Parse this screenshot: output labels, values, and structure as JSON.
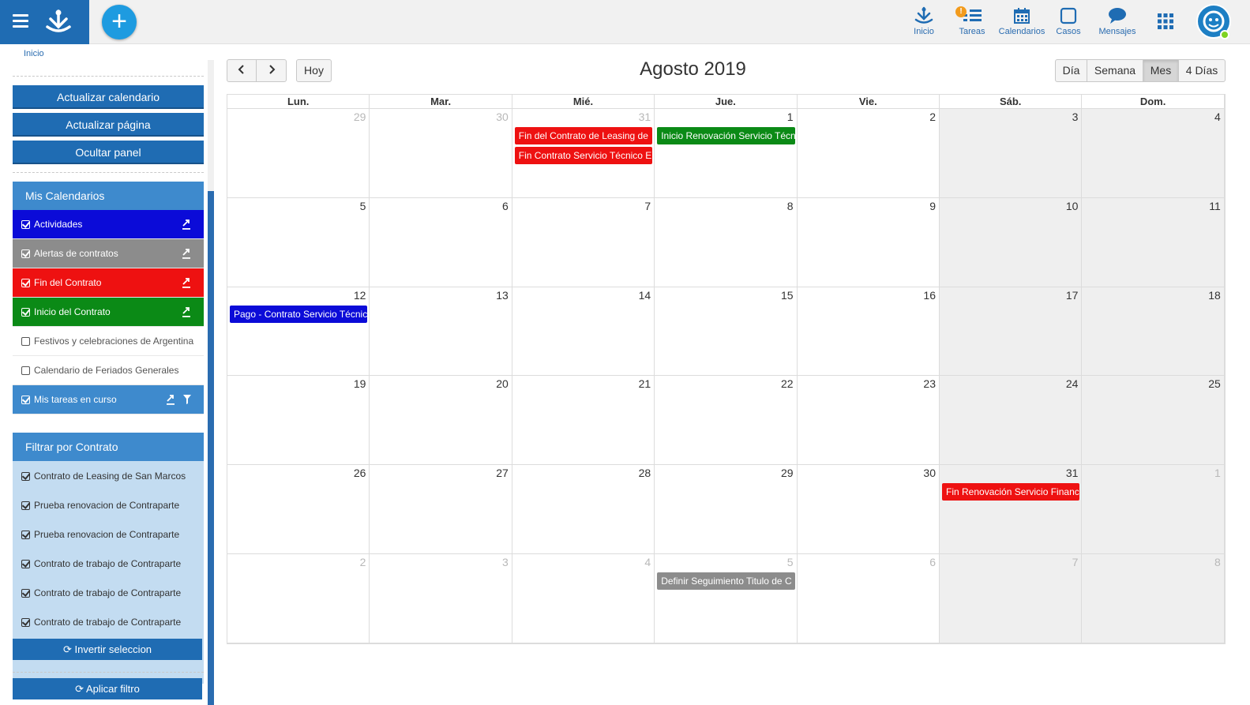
{
  "topbar": {
    "nav": [
      {
        "key": "inicio",
        "label": "Inicio",
        "icon": "home-logo-icon"
      },
      {
        "key": "tareas",
        "label": "Tareas",
        "icon": "tasks-icon",
        "badge": "!"
      },
      {
        "key": "calendarios",
        "label": "Calendarios",
        "icon": "calendar-icon"
      },
      {
        "key": "casos",
        "label": "Casos",
        "icon": "square-icon"
      },
      {
        "key": "mensajes",
        "label": "Mensajes",
        "icon": "chat-icon"
      }
    ],
    "accent": "#1f6cb3"
  },
  "sidebar": {
    "breadcrumb": "Inicio",
    "buttons": {
      "refresh_calendar": "Actualizar calendario",
      "refresh_page": "Actualizar página",
      "hide_panel": "Ocultar panel"
    },
    "my_calendars_title": "Mis Calendarios",
    "calendars": [
      {
        "label": "Actividades",
        "checked": true,
        "color": "#0b0bd8"
      },
      {
        "label": "Alertas de contratos",
        "checked": true,
        "color": "#8c8c8c"
      },
      {
        "label": "Fin del Contrato",
        "checked": true,
        "color": "#ee1111"
      },
      {
        "label": "Inicio del Contrato",
        "checked": true,
        "color": "#0b8a16"
      },
      {
        "label": "Festivos y celebraciones de Argentina",
        "checked": false,
        "color": "#ffffff"
      },
      {
        "label": "Calendario de Feriados Generales",
        "checked": false,
        "color": "#ffffff"
      },
      {
        "label": "Mis tareas en curso",
        "checked": true,
        "color": "#3e8acd"
      }
    ],
    "filter_title": "Filtrar por Contrato",
    "filters": [
      "Contrato de Leasing de San Marcos",
      "Prueba renovacion de Contraparte",
      "Prueba renovacion de Contraparte",
      "Contrato de trabajo de Contraparte",
      "Contrato de trabajo de Contraparte",
      "Contrato de trabajo de Contraparte"
    ],
    "invert_label": "Invertir seleccion",
    "apply_label": "Aplicar filtro"
  },
  "calendar": {
    "title": "Agosto 2019",
    "today_label": "Hoy",
    "views": [
      "Día",
      "Semana",
      "Mes",
      "4 Días"
    ],
    "active_view": "Mes",
    "weekdays": [
      "Lun.",
      "Mar.",
      "Mié.",
      "Jue.",
      "Vie.",
      "Sáb.",
      "Dom."
    ],
    "weeks": [
      [
        {
          "d": "29",
          "o": true
        },
        {
          "d": "30",
          "o": true
        },
        {
          "d": "31",
          "o": true
        },
        {
          "d": "1"
        },
        {
          "d": "2"
        },
        {
          "d": "3"
        },
        {
          "d": "4"
        }
      ],
      [
        {
          "d": "5"
        },
        {
          "d": "6"
        },
        {
          "d": "7"
        },
        {
          "d": "8"
        },
        {
          "d": "9"
        },
        {
          "d": "10"
        },
        {
          "d": "11"
        }
      ],
      [
        {
          "d": "12"
        },
        {
          "d": "13"
        },
        {
          "d": "14"
        },
        {
          "d": "15"
        },
        {
          "d": "16"
        },
        {
          "d": "17"
        },
        {
          "d": "18"
        }
      ],
      [
        {
          "d": "19"
        },
        {
          "d": "20"
        },
        {
          "d": "21"
        },
        {
          "d": "22"
        },
        {
          "d": "23"
        },
        {
          "d": "24"
        },
        {
          "d": "25"
        }
      ],
      [
        {
          "d": "26"
        },
        {
          "d": "27"
        },
        {
          "d": "28"
        },
        {
          "d": "29"
        },
        {
          "d": "30"
        },
        {
          "d": "31"
        },
        {
          "d": "1",
          "o": true
        }
      ],
      [
        {
          "d": "2",
          "o": true
        },
        {
          "d": "3",
          "o": true
        },
        {
          "d": "4",
          "o": true
        },
        {
          "d": "5",
          "o": true
        },
        {
          "d": "6",
          "o": true
        },
        {
          "d": "7",
          "o": true
        },
        {
          "d": "8",
          "o": true
        }
      ]
    ],
    "events": [
      {
        "week": 0,
        "day": 2,
        "slot": 0,
        "title": "Fin del Contrato de Leasing de",
        "color": "#ee1111"
      },
      {
        "week": 0,
        "day": 2,
        "slot": 1,
        "title": "Fin Contrato Servicio Técnico E",
        "color": "#ee1111"
      },
      {
        "week": 0,
        "day": 3,
        "slot": 0,
        "title": "Inicio Renovación Servicio Técni",
        "color": "#0b8a16"
      },
      {
        "week": 2,
        "day": 0,
        "slot": 0,
        "title": "Pago - Contrato Servicio Técnic",
        "color": "#0b0bd8"
      },
      {
        "week": 4,
        "day": 5,
        "slot": 0,
        "title": "Fin Renovación Servicio Financ",
        "color": "#ee1111"
      },
      {
        "week": 5,
        "day": 3,
        "slot": 0,
        "title": "Definir Seguimiento Titulo de C",
        "color": "#8c8c8c"
      }
    ]
  }
}
